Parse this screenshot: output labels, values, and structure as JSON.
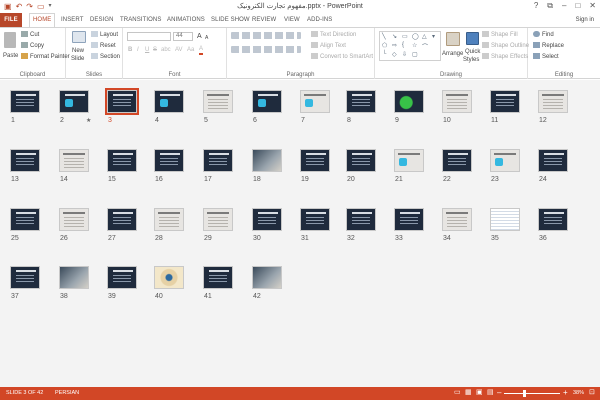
{
  "window": {
    "title": "مفهوم تجارت الکترونیک.pptx - PowerPoint",
    "qat_icons": [
      "save-icon",
      "undo-icon",
      "redo-icon",
      "start-from-beginning-icon",
      "customize-qat-icon"
    ],
    "controls": {
      "help": "?",
      "restore": "⧉",
      "minimize": "–",
      "maximize": "□",
      "close": "✕"
    }
  },
  "tabs": [
    {
      "label": "FILE"
    },
    {
      "label": "HOME"
    },
    {
      "label": "INSERT"
    },
    {
      "label": "DESIGN"
    },
    {
      "label": "TRANSITIONS"
    },
    {
      "label": "ANIMATIONS"
    },
    {
      "label": "SLIDE SHOW"
    },
    {
      "label": "REVIEW"
    },
    {
      "label": "VIEW"
    },
    {
      "label": "ADD-INS"
    }
  ],
  "signin": "Sign in",
  "ribbon": {
    "clipboard": {
      "label": "Clipboard",
      "paste": "Paste",
      "cut": "Cut",
      "copy": "Copy",
      "format_painter": "Format Painter"
    },
    "slides": {
      "label": "Slides",
      "new_slide_line1": "New",
      "new_slide_line2": "Slide",
      "layout": "Layout",
      "reset": "Reset",
      "section": "Section"
    },
    "font": {
      "label": "Font",
      "size": "44",
      "grow": "A",
      "shrink": "A",
      "bold": "B",
      "italic": "I",
      "underline": "U",
      "strike": "S",
      "shadow": "abc",
      "spacing": "AV",
      "case": "Aa",
      "color": "A"
    },
    "paragraph": {
      "label": "Paragraph",
      "text_direction": "Text Direction",
      "align_text": "Align Text",
      "smartart": "Convert to SmartArt"
    },
    "drawing": {
      "label": "Drawing",
      "arrange": "Arrange",
      "quick_styles_line1": "Quick",
      "quick_styles_line2": "Styles",
      "shape_fill": "Shape Fill",
      "shape_outline": "Shape Outline",
      "shape_effects": "Shape Effects"
    },
    "editing": {
      "label": "Editing",
      "find": "Find",
      "replace": "Replace",
      "select": "Select"
    }
  },
  "slides": [
    {
      "num": "1",
      "style": "dark"
    },
    {
      "num": "2",
      "style": "dark",
      "accent": true,
      "star": "★"
    },
    {
      "num": "3",
      "style": "dark",
      "selected": true
    },
    {
      "num": "4",
      "style": "dark",
      "accent": true
    },
    {
      "num": "5",
      "style": "light"
    },
    {
      "num": "6",
      "style": "dark",
      "accent": true
    },
    {
      "num": "7",
      "style": "light",
      "accent": true
    },
    {
      "num": "8",
      "style": "dark"
    },
    {
      "num": "9",
      "style": "green"
    },
    {
      "num": "10",
      "style": "light"
    },
    {
      "num": "11",
      "style": "dark"
    },
    {
      "num": "12",
      "style": "light"
    },
    {
      "num": "13",
      "style": "dark"
    },
    {
      "num": "14",
      "style": "light"
    },
    {
      "num": "15",
      "style": "dark"
    },
    {
      "num": "16",
      "style": "dark"
    },
    {
      "num": "17",
      "style": "dark"
    },
    {
      "num": "18",
      "style": "photo"
    },
    {
      "num": "19",
      "style": "dark"
    },
    {
      "num": "20",
      "style": "dark"
    },
    {
      "num": "21",
      "style": "light",
      "accent": true
    },
    {
      "num": "22",
      "style": "dark"
    },
    {
      "num": "23",
      "style": "light",
      "accent": true
    },
    {
      "num": "24",
      "style": "dark"
    },
    {
      "num": "25",
      "style": "dark"
    },
    {
      "num": "26",
      "style": "light"
    },
    {
      "num": "27",
      "style": "dark"
    },
    {
      "num": "28",
      "style": "light"
    },
    {
      "num": "29",
      "style": "light"
    },
    {
      "num": "30",
      "style": "dark"
    },
    {
      "num": "31",
      "style": "dark"
    },
    {
      "num": "32",
      "style": "dark"
    },
    {
      "num": "33",
      "style": "dark"
    },
    {
      "num": "34",
      "style": "light"
    },
    {
      "num": "35",
      "style": "sheet"
    },
    {
      "num": "36",
      "style": "dark"
    },
    {
      "num": "37",
      "style": "dark"
    },
    {
      "num": "38",
      "style": "photo"
    },
    {
      "num": "39",
      "style": "dark"
    },
    {
      "num": "40",
      "style": "eye"
    },
    {
      "num": "41",
      "style": "dark"
    },
    {
      "num": "42",
      "style": "photo"
    }
  ],
  "status": {
    "slide_info": "SLIDE 3 OF 42",
    "language": "PERSIAN",
    "zoom": "38%",
    "zoom_out": "–",
    "zoom_in": "+",
    "zoom_level": 0.38,
    "view_icons": [
      "normal-view-icon",
      "slide-sorter-icon",
      "reading-view-icon",
      "slide-show-icon"
    ]
  }
}
